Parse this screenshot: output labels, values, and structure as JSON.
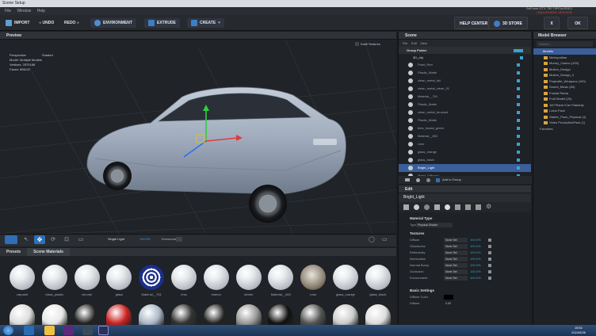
{
  "window": {
    "title": "Scene Setup"
  },
  "menu": [
    "File",
    "Window",
    "Help"
  ],
  "gpu": {
    "line1": "GeForce GTX 750 Ti/PCIe/SSE2",
    "line2": "UNLICENSED VERSION"
  },
  "toolbar": {
    "import": "IMPORT",
    "undo": "UNDO",
    "redo": "REDO",
    "environment": "ENVIRONMENT",
    "extrude": "EXTRUDE",
    "create": "CREATE",
    "help_center": "HELP CENTER",
    "store": "3D STORE",
    "close": "X",
    "ok": "OK"
  },
  "preview": {
    "title": "Preview",
    "draft_textures": "Draft Textures",
    "view_mode": "Perspective",
    "shading": "Shaded",
    "info": [
      {
        "label": "Model:",
        "value": "Multiple Models"
      },
      {
        "label": "Vertices:",
        "value": "2570188"
      },
      {
        "label": "Faces:",
        "value": "856122"
      }
    ],
    "light": "Single Light",
    "light_pct": "100.0%",
    "environment_label": "Environment"
  },
  "lower": {
    "tabs": [
      "Presets",
      "Scene Materials"
    ],
    "materials": [
      "carpaint",
      "black_plastic",
      "chrome",
      "glass",
      "Material__761",
      "rims",
      "interior",
      "rubber",
      "Material__802",
      "rotor",
      "glass_orange",
      "glass_black"
    ]
  },
  "scene": {
    "title": "Scene",
    "menu": [
      "File",
      "Edit",
      "View"
    ],
    "group": "Group Folder",
    "object": "3D_obj",
    "items": [
      "Paint_Red",
      "Plastic_Matte",
      "clean_metal_foil",
      "clean_metal_clean_01",
      "Material__761",
      "Plastic_Matte",
      "clean_metal_brushed",
      "Plastic_Matte",
      "tires_fractal_green",
      "Material__802",
      "rotor",
      "glass_orange",
      "glass_black",
      "Bright_Light",
      "Metal_Diffused"
    ],
    "selected": "Bright_Light",
    "add_to_group": "Add to Group"
  },
  "edit": {
    "title": "Edit",
    "object_name": "Bright_Light",
    "material_type_label": "Material Type",
    "type_label": "Type",
    "type_value": "Physical Shader",
    "textures_label": "Textures",
    "rows": [
      {
        "name": "Diffuse",
        "value": "None Set",
        "pct": "100.0%"
      },
      {
        "name": "Glossiness",
        "value": "None Set",
        "pct": "100.0%"
      },
      {
        "name": "Reflectivity",
        "value": "None Set",
        "pct": "100.0%"
      },
      {
        "name": "Illumination",
        "value": "None Set",
        "pct": "100.0%"
      },
      {
        "name": "Normal Bump",
        "value": "None Set",
        "pct": "100.0%"
      },
      {
        "name": "Occlusion",
        "value": "None Set",
        "pct": "100.0%"
      },
      {
        "name": "Environment",
        "value": "None Set",
        "pct": "100.0%"
      }
    ],
    "basic_settings_label": "Basic Settings",
    "diffuse_color_label": "Diffuse Color",
    "diffuse_label": "Diffuse",
    "diffuse_value": "0.00"
  },
  "browser": {
    "title": "Model Browser",
    "search_placeholder": "Search...",
    "items": [
      "Models",
      "Metropolitan",
      "Money_Casino (100)",
      "Motion_Design",
      "Motion_Design_2",
      "Projectile_Weapons (100)",
      "Sound_Music (84)",
      "Fractal Rama",
      "Fruit Model (20)",
      "Jet+Plane+Car+Starship",
      "Lotus Pack",
      "Starter_Pack_Physical (4)",
      "Video ProductionPack (1)",
      "Favorites"
    ]
  },
  "taskbar": {
    "time": "15:51",
    "date": "2024/5/26"
  },
  "colors": {
    "accent": "#3a5f9a",
    "selection": "#2f6fb7",
    "folder": "#d9a441",
    "car": "#9eaabb"
  }
}
